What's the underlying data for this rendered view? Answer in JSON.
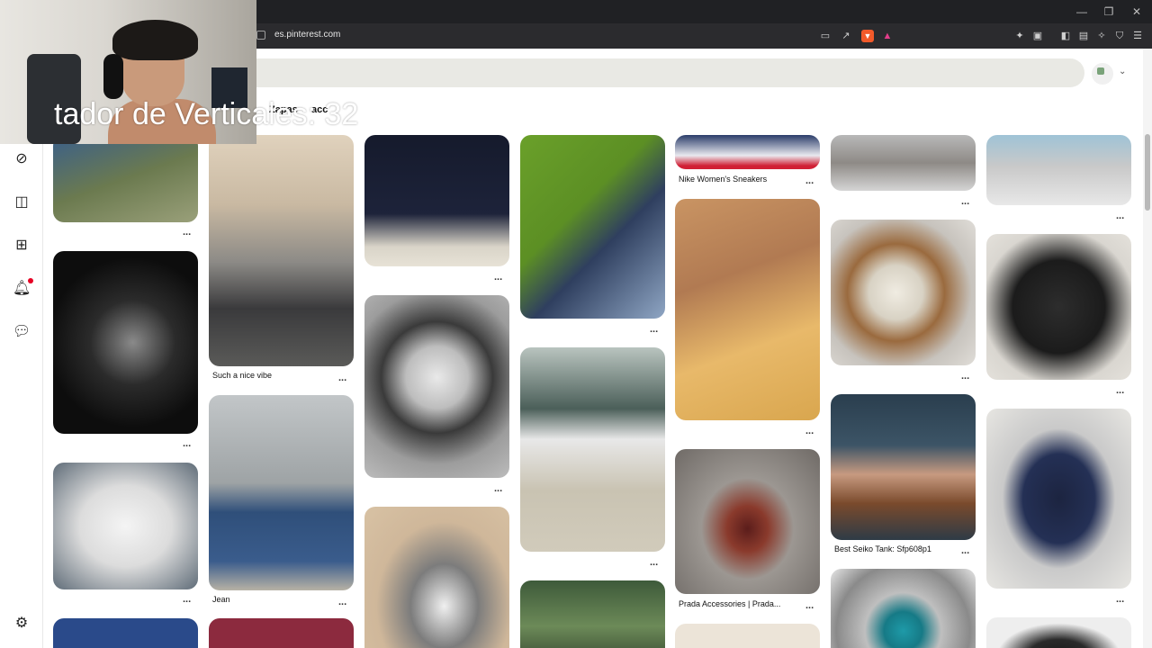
{
  "browser": {
    "url": "es.pinterest.com",
    "window_controls": [
      "—",
      "❐",
      "✕"
    ]
  },
  "header": {
    "board_tabs": [
      "Zapas",
      "acc"
    ]
  },
  "overlay": {
    "text": "tador de Verticales: 32"
  },
  "sidebar": {
    "icons": [
      "explore-icon",
      "boards-icon",
      "create-icon",
      "notifications-icon",
      "messages-icon",
      "settings-icon"
    ]
  },
  "pins": {
    "col2_title1": "Such a nice vibe",
    "col2_title2": "Jean",
    "col5_title1": "Nike Women's Sneakers",
    "col5_title2": "Prada Accessories | Prada...",
    "col6_title1": "Best Seiko Tank: Sfp608p1",
    "more": "..."
  },
  "colors": {
    "accent": "#e60023",
    "search_bg": "#e9e9e4"
  }
}
